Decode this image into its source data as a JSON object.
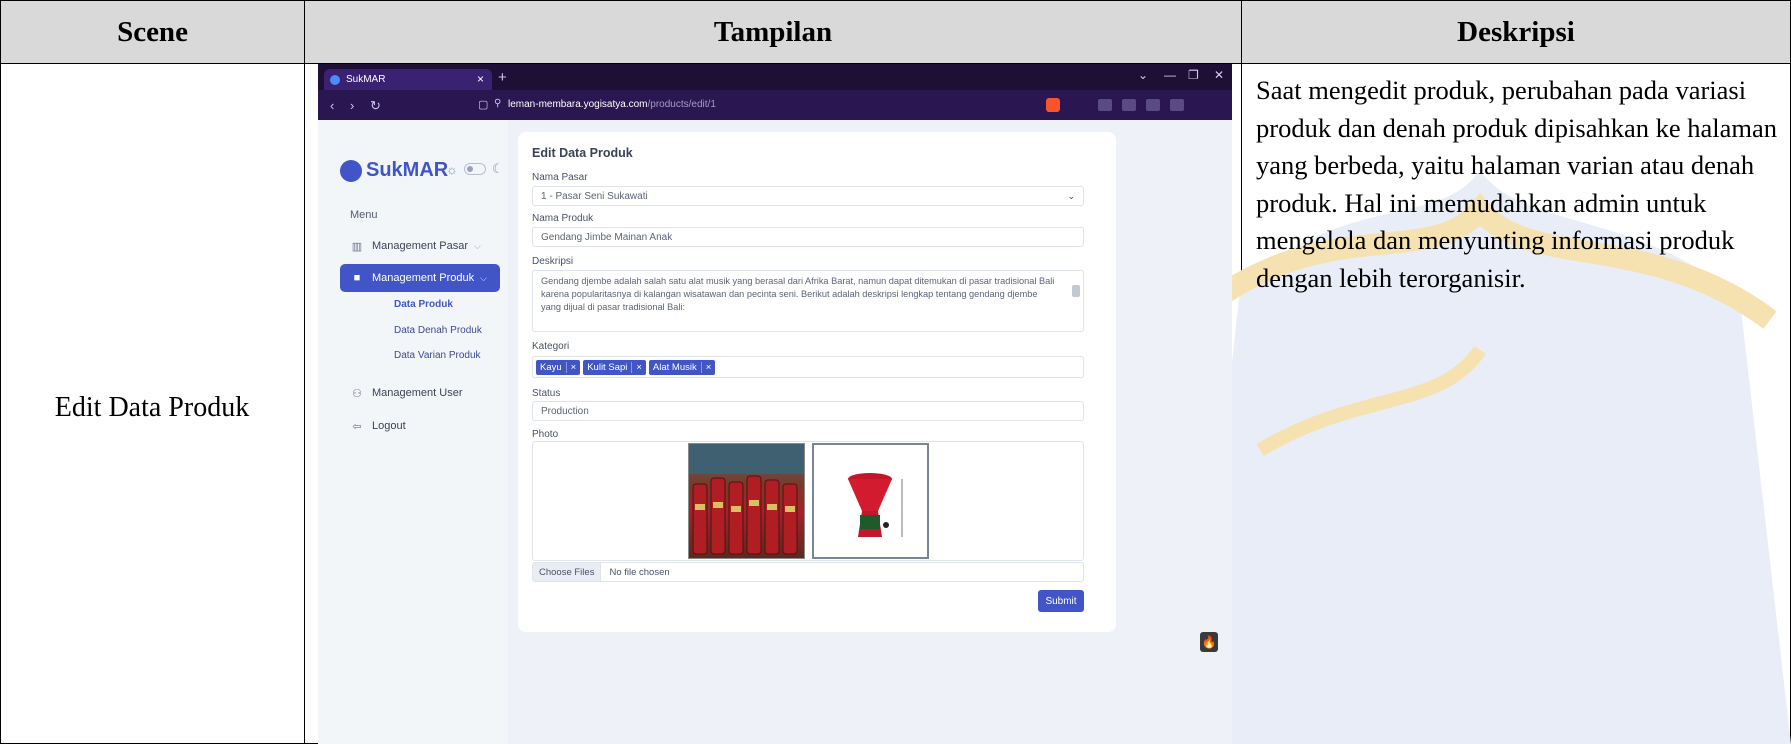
{
  "table": {
    "headers": {
      "scene": "Scene",
      "view": "Tampilan",
      "description": "Deskripsi"
    },
    "scene": "Edit Data Produk",
    "description": "Saat mengedit produk, perubahan pada variasi produk dan denah produk dipisahkan ke halaman yang berbeda, yaitu halaman varian atau denah produk. Hal ini memudahkan admin untuk mengelola dan menyunting informasi produk dengan lebih terorganisir."
  },
  "browser": {
    "tab_title": "SukMAR",
    "tab_close": "×",
    "new_tab": "+",
    "window_controls": [
      "⌄",
      "—",
      "❐",
      "✕"
    ],
    "url_host": "leman-membara.yogisatya.com",
    "url_path": "/products/edit/1"
  },
  "sidebar": {
    "logo": "SukMAR",
    "menu_label": "Menu",
    "items": [
      {
        "label": "Management Pasar",
        "icon": "building-icon"
      },
      {
        "label": "Management Produk",
        "icon": "bag-icon"
      },
      {
        "label": "Management User",
        "icon": "users-icon"
      },
      {
        "label": "Logout",
        "icon": "logout-icon"
      }
    ],
    "sub_items": [
      "Data Produk",
      "Data Denah Produk",
      "Data Varian Produk"
    ]
  },
  "form": {
    "title": "Edit Data Produk",
    "pasar_label": "Nama Pasar",
    "pasar_value": "1 - Pasar Seni Sukawati",
    "produk_label": "Nama Produk",
    "produk_value": "Gendang Jimbe Mainan Anak",
    "deskripsi_label": "Deskripsi",
    "deskripsi_value": "Gendang djembe adalah salah satu alat musik yang berasal dari Afrika Barat, namun dapat ditemukan di pasar tradisional Bali karena popularitasnya di kalangan wisatawan dan pecinta seni. Berikut adalah deskripsi lengkap tentang gendang djembe yang dijual di pasar tradisional Bali:",
    "kategori_label": "Kategori",
    "kategori_tags": [
      "Kayu",
      "Kulit Sapi",
      "Alat Musik"
    ],
    "tag_remove": "×",
    "status_label": "Status",
    "status_value": "Production",
    "photo_label": "Photo",
    "file_button": "Choose Files",
    "file_status": "No file chosen",
    "submit_label": "Submit"
  },
  "colors": {
    "accent": "#4155c7",
    "header_bg": "#d9d9d9",
    "browser_bg": "#1d0f36"
  }
}
